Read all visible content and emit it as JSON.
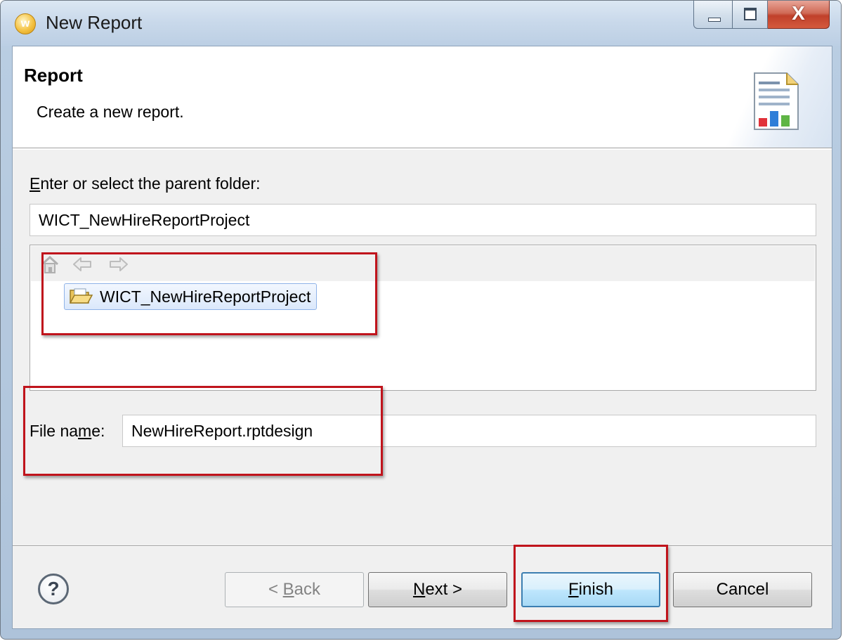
{
  "window": {
    "title": "New Report",
    "app_icon_letter": "w",
    "close_glyph": "X"
  },
  "header": {
    "title": "Report",
    "description": "Create a new report."
  },
  "folder": {
    "prompt_underlined_char": "E",
    "prompt_rest": "nter or select the parent folder:",
    "value": "WICT_NewHireReportProject"
  },
  "tree": {
    "items": [
      {
        "label": "WICT_NewHireReportProject",
        "selected": true
      }
    ]
  },
  "file": {
    "label_part1": "File na",
    "label_underlined_char": "m",
    "label_part2": "e:",
    "value": "NewHireReport.rptdesign"
  },
  "buttons": {
    "help_glyph": "?",
    "back_prefix": "< ",
    "back_underlined_char": "B",
    "back_rest": "ack",
    "next_underlined_char": "N",
    "next_rest": "ext >",
    "finish_underlined_char": "F",
    "finish_rest": "inish",
    "cancel_label": "Cancel"
  },
  "colors": {
    "annotation": "#c0141c",
    "default_button": "#3c7fb1",
    "selection": "#dbe8fb"
  }
}
